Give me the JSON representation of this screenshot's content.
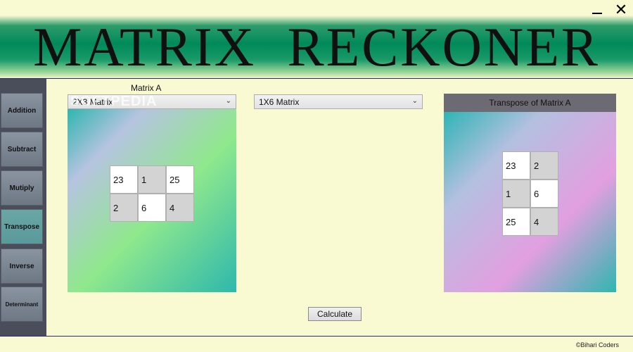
{
  "window": {
    "minimize_glyph": "—",
    "close_glyph": "✕"
  },
  "banner": {
    "title": "MATRIX  RECKONER"
  },
  "sidebar": {
    "items": [
      {
        "label": "Addition"
      },
      {
        "label": "Subtract"
      },
      {
        "label": "Mutiply"
      },
      {
        "label": "Transpose"
      },
      {
        "label": "Inverse"
      },
      {
        "label": "Determinant"
      }
    ],
    "active": "Transpose"
  },
  "matrix_a": {
    "label": "Matrix A",
    "size_select": "2X3  Matrix",
    "cells": [
      [
        "23",
        "1",
        "25"
      ],
      [
        "2",
        "6",
        "4"
      ]
    ]
  },
  "matrix_b": {
    "size_select": "1X6  Matrix"
  },
  "result": {
    "header": "Transpose of Matrix A",
    "cells": [
      [
        "23",
        "2"
      ],
      [
        "1",
        "6"
      ],
      [
        "25",
        "4"
      ]
    ]
  },
  "actions": {
    "calculate_label": "Calculate"
  },
  "watermark": "SOFTPEDIA",
  "footer": {
    "copyright": "©Bihari Coders"
  },
  "colors": {
    "background": "#f9f9d2",
    "banner": "#008a5a",
    "sidebar": "#4a4d5a",
    "active_item": "#5a9a9a"
  },
  "icons": {
    "dropdown": "chevron-down-icon"
  }
}
